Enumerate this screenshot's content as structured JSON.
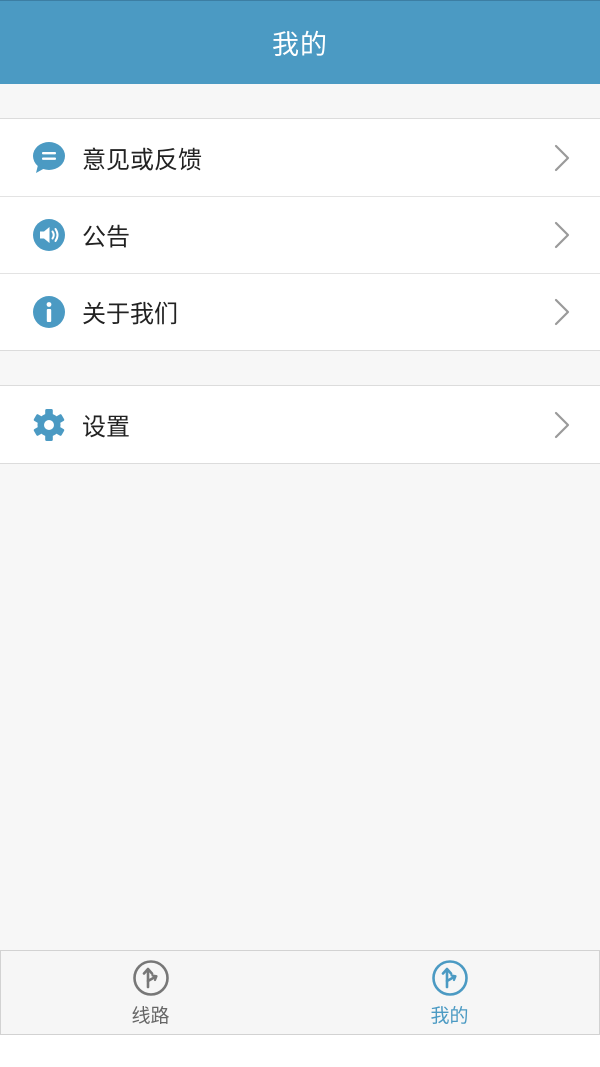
{
  "header": {
    "title": "我的"
  },
  "menu_group_1": [
    {
      "label": "意见或反馈",
      "icon": "chat-bubble-icon"
    },
    {
      "label": "公告",
      "icon": "speaker-icon"
    },
    {
      "label": "关于我们",
      "icon": "info-icon"
    }
  ],
  "menu_group_2": [
    {
      "label": "设置",
      "icon": "gear-icon"
    }
  ],
  "tabbar": {
    "tabs": [
      {
        "label": "线路",
        "icon": "route-icon",
        "active": false
      },
      {
        "label": "我的",
        "icon": "route-icon",
        "active": true
      }
    ]
  },
  "colors": {
    "accent": "#4b9ac3",
    "background": "#f7f7f7",
    "text": "#222222",
    "chevron": "#9a9a9a",
    "tab_inactive": "#666666"
  }
}
